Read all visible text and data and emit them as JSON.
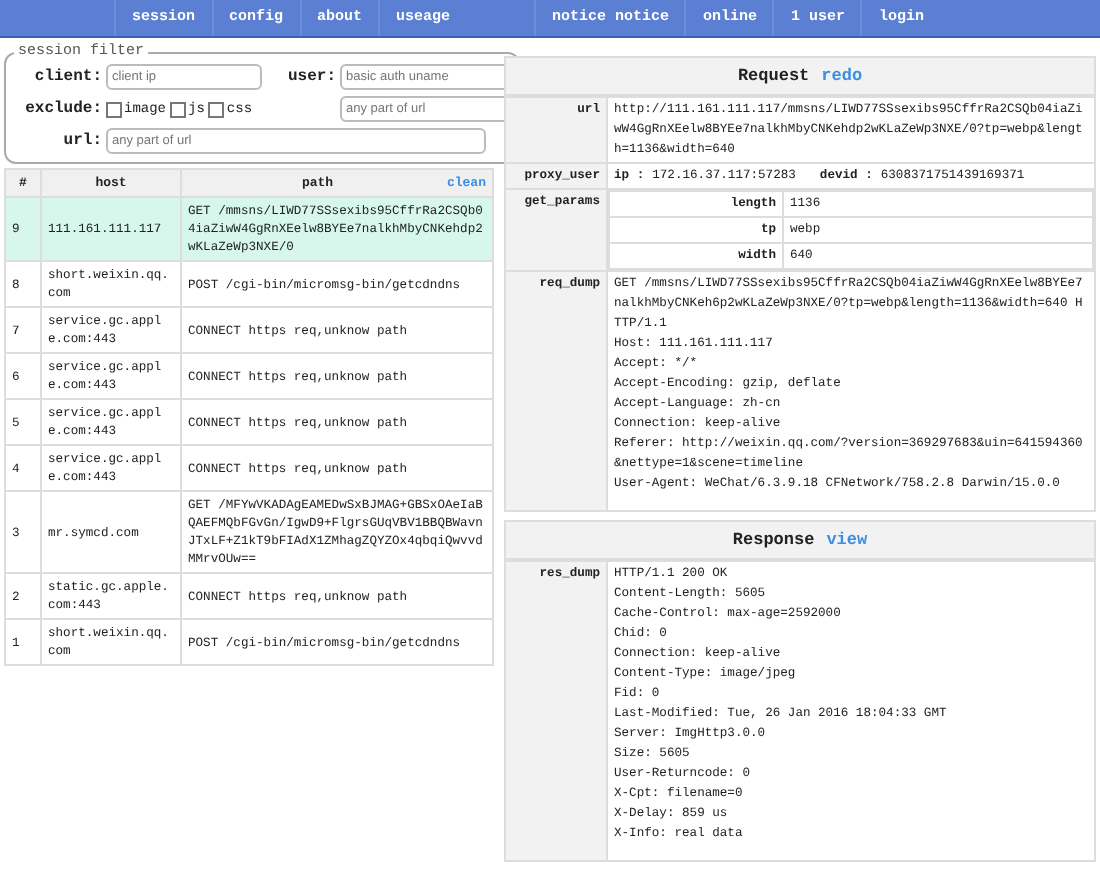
{
  "nav": {
    "left": [
      "session",
      "config",
      "about",
      "useage"
    ],
    "right": [
      "notice notice",
      "online",
      "1 user",
      "login"
    ]
  },
  "filter": {
    "legend": "session filter",
    "client": {
      "label": "client:",
      "placeholder": "client ip"
    },
    "user": {
      "label": "user:",
      "placeholder": "basic auth uname"
    },
    "exclude": {
      "label": "exclude:",
      "placeholder": "any part of url"
    },
    "checkboxes": [
      {
        "label": "image",
        "checked": false
      },
      {
        "label": "js",
        "checked": false
      },
      {
        "label": "css",
        "checked": false
      }
    ],
    "url": {
      "label": "url:",
      "placeholder": "any part of url"
    }
  },
  "table": {
    "columns": [
      "#",
      "host",
      "path"
    ],
    "clean": "clean",
    "rows": [
      {
        "num": "9",
        "host": "111.161.111.117",
        "path": "GET /mmsns/LIWD77SSsexibs95CffrRa2CSQb04iaZiwW4GgRnXEelw8BYEe7nalkhMbyCNKehdp2wKLaZeWp3NXE/0",
        "selected": true
      },
      {
        "num": "8",
        "host": "short.weixin.qq.com",
        "path": "POST /cgi-bin/micromsg-bin/getcdndns",
        "selected": false
      },
      {
        "num": "7",
        "host": "service.gc.apple.com:443",
        "path": "CONNECT https req,unknow path",
        "selected": false
      },
      {
        "num": "6",
        "host": "service.gc.apple.com:443",
        "path": "CONNECT https req,unknow path",
        "selected": false
      },
      {
        "num": "5",
        "host": "service.gc.apple.com:443",
        "path": "CONNECT https req,unknow path",
        "selected": false
      },
      {
        "num": "4",
        "host": "service.gc.apple.com:443",
        "path": "CONNECT https req,unknow path",
        "selected": false
      },
      {
        "num": "3",
        "host": "mr.symcd.com",
        "path": "GET /MFYwVKADAgEAMEDwSxBJMAG+GBSxOAeIaBQAEFMQbFGvGn/IgwD9+FlgrsGUqVBV1BBQBWavnJTxLF+Z1kT9bFIAdX1ZMhagZQYZOx4qbqiQwvvdMMrvOUw==",
        "selected": false
      },
      {
        "num": "2",
        "host": "static.gc.apple.com:443",
        "path": "CONNECT https req,unknow path",
        "selected": false
      },
      {
        "num": "1",
        "host": "short.weixin.qq.com",
        "path": "POST /cgi-bin/micromsg-bin/getcdndns",
        "selected": false
      }
    ]
  },
  "request": {
    "title": "Request",
    "action": "redo",
    "url_label": "url",
    "url": "http://111.161.111.117/mmsns/LIWD77SSsexibs95CffrRa2CSQb04iaZiwW4GgRnXEelw8BYEe7nalkhMbyCNKehdp2wKLaZeWp3NXE/0?tp=webp&length=1136&width=640",
    "proxy_label": "proxy_user",
    "ip_label": "ip :",
    "ip": "172.16.37.117:57283",
    "devid_label": "devid :",
    "devid": "6308371751439169371",
    "params_label": "get_params",
    "params": [
      {
        "name": "length",
        "value": "1136"
      },
      {
        "name": "tp",
        "value": "webp"
      },
      {
        "name": "width",
        "value": "640"
      }
    ],
    "dump_label": "req_dump",
    "dump": [
      "GET /mmsns/LIWD77SSsexibs95CffrRa2CSQb04iaZiwW4GgRnXEelw8BYEe7nalkhMbyCNKeh6p2wKLaZeWp3NXE/0?tp=webp&length=1136&width=640 HTTP/1.1",
      "Host: 111.161.111.117",
      "Accept: */*",
      "Accept-Encoding: gzip, deflate",
      "Accept-Language: zh-cn",
      "Connection: keep-alive",
      "Referer: http://weixin.qq.com/?version=369297683&uin=641594360&nettype=1&scene=timeline",
      "User-Agent: WeChat/6.3.9.18 CFNetwork/758.2.8 Darwin/15.0.0"
    ]
  },
  "response": {
    "title": "Response",
    "action": "view",
    "dump_label": "res_dump",
    "dump": [
      "HTTP/1.1 200 OK",
      "Content-Length: 5605",
      "Cache-Control: max-age=2592000",
      "Chid: 0",
      "Connection: keep-alive",
      "Content-Type: image/jpeg",
      "Fid: 0",
      "Last-Modified: Tue, 26 Jan 2016 18:04:33 GMT",
      "Server: ImgHttp3.0.0",
      "Size: 5605",
      "User-Returncode: 0",
      "X-Cpt: filename=0",
      "X-Delay: 859 us",
      "X-Info: real data"
    ]
  }
}
